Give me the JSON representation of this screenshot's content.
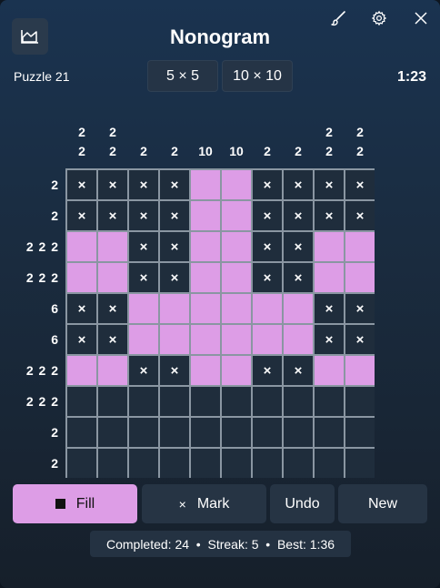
{
  "app": {
    "title": "Nonogram"
  },
  "header": {
    "puzzle_label": "Puzzle 21",
    "size_options": [
      "5 × 5",
      "10 × 10"
    ],
    "selected_size": "10 × 10",
    "timer": "1:23"
  },
  "toolbar_icons": [
    "stats-icon",
    "brush-icon",
    "gear-icon",
    "close-icon"
  ],
  "puzzle": {
    "col_clues": [
      [
        "2",
        "2"
      ],
      [
        "2",
        "2"
      ],
      [
        "2"
      ],
      [
        "2"
      ],
      [
        "10"
      ],
      [
        "10"
      ],
      [
        "2"
      ],
      [
        "2"
      ],
      [
        "2",
        "2"
      ],
      [
        "2",
        "2"
      ]
    ],
    "row_clues": [
      "2",
      "2",
      "2 2 2",
      "2 2 2",
      "6",
      "6",
      "2 2 2",
      "2 2 2",
      "2",
      "2"
    ],
    "cells": [
      "xxxxffxxxx",
      "xxxxffxxxx",
      "ffxxffxxff",
      "ffxxffxxff",
      "xxffffffxx",
      "xxffffffxx",
      "ffxxffxxff",
      "..........",
      "..........",
      ".........."
    ],
    "mark_symbol": "×"
  },
  "controls": {
    "fill_label": "Fill",
    "mark_label": "Mark",
    "mark_symbol": "×",
    "undo_label": "Undo",
    "new_label": "New",
    "active_mode": "fill"
  },
  "status": {
    "text": "Completed: 24  •  Streak: 5  •  Best: 1:36"
  },
  "colors": {
    "fill": "#dd9de6",
    "empty": "#1f2d3c",
    "grid_line": "#8a96a2"
  }
}
